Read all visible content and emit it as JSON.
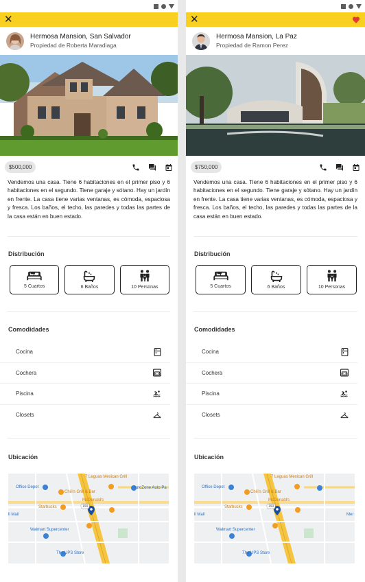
{
  "listings": [
    {
      "title": "Hermosa Mansion, San Salvador",
      "owner": "Propiedad de Roberta Maradiaga",
      "price": "$500,000",
      "favorite": false,
      "description": "Vendemos una casa. Tiene 6 habitaciones en el primer piso y 6 habitaciones en el segundo. Tiene garaje y sótano. Hay un jardín en frente. La casa tiene varias ventanas, es cómoda, espaciosa y fresca. Los baños, el techo, las paredes y todas las partes de la casa están en buen estado.",
      "distribution_title": "Distribución",
      "distribution": [
        {
          "icon": "bed-icon",
          "label": "5 Cuartos"
        },
        {
          "icon": "bathtub-icon",
          "label": "6 Baños"
        },
        {
          "icon": "people-icon",
          "label": "10 Personas"
        }
      ],
      "amenities_title": "Comodidades",
      "amenities": [
        {
          "label": "Cocina",
          "icon": "kitchen-icon"
        },
        {
          "label": "Cochera",
          "icon": "garage-icon"
        },
        {
          "label": "Piscina",
          "icon": "pool-icon"
        },
        {
          "label": "Closets",
          "icon": "hanger-icon"
        }
      ],
      "location_title": "Ubicación"
    },
    {
      "title": "Hermosa Mansion, La Paz",
      "owner": "Propiedad de Ramon Perez",
      "price": "$750,000",
      "favorite": true,
      "description": "Vendemos una casa. Tiene 6 habitaciones en el primer piso y 6 habitaciones en el segundo. Tiene garaje y sótano. Hay un jardín en frente. La casa tiene varias ventanas, es cómoda, espaciosa y fresca. Los baños, el techo, las paredes y todas las partes de la casa están en buen estado.",
      "distribution_title": "Distribución",
      "distribution": [
        {
          "icon": "bed-icon",
          "label": "5 Cuartos"
        },
        {
          "icon": "bathtub-icon",
          "label": "6 Baños"
        },
        {
          "icon": "people-icon",
          "label": "10 Personas"
        }
      ],
      "amenities_title": "Comodidades",
      "amenities": [
        {
          "label": "Cocina",
          "icon": "kitchen-icon"
        },
        {
          "label": "Cochera",
          "icon": "garage-icon"
        },
        {
          "label": "Piscina",
          "icon": "pool-icon"
        },
        {
          "label": "Closets",
          "icon": "hanger-icon"
        }
      ],
      "location_title": "Ubicación"
    }
  ],
  "map_labels": {
    "restaurant1": "7 Leguas Mexican Grill",
    "office": "Office Depot",
    "chilis": "Chili's Grill & Bar",
    "autozone": "AutoZone Auto Pa",
    "mcdonalds": "McDonald's",
    "starbucks": "Starbucks",
    "mall": "ll Mall",
    "walmart": "Walmart Supercenter",
    "ups": "The UPS Store",
    "road": "190",
    "mer": "Mer"
  },
  "colors": {
    "accent": "#f9d020",
    "favorite": "#e53935",
    "map_pin": "#1a4fa0"
  }
}
